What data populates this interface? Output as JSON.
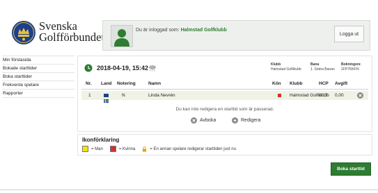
{
  "brand": {
    "line1": "Svenska",
    "line2": "Golfförbundet"
  },
  "login": {
    "text": "Du är inloggad som:",
    "club": "Halmstad Golfklubb",
    "logout_label": "Logga ut"
  },
  "sidebar": {
    "items": [
      {
        "label": "Min förstasida"
      },
      {
        "label": "Bokade starttider"
      },
      {
        "label": "Boka starttider"
      },
      {
        "label": "Frekventa spelare"
      },
      {
        "label": "Rapporter"
      }
    ]
  },
  "booking": {
    "datetime": "2018-04-19, 15:42",
    "info": {
      "club_label": "Klubb",
      "club_value": "Halmstad Golfklubb",
      "course_label": "Bana",
      "course_value": "1. Södra Banan",
      "booking_label": "Bokningsnr.",
      "booking_value": "1FP7RKFN"
    },
    "columns": {
      "nr": "Nr.",
      "land": "Land",
      "notering": "Notering",
      "namn": "Namn",
      "kon": "Kön",
      "klubb": "Klubb",
      "hcp": "HCP",
      "avgift": "Avgift"
    },
    "rows": [
      {
        "nr": "1",
        "notering": "N",
        "namn": "Linda Nevrén",
        "klubb": "Halmstad Golfklubb",
        "hcp": "10,7",
        "avgift": "0,00"
      }
    ],
    "notice": "Du kan inte redigera en starttid som är passerad.",
    "cancel_label": "Avboka",
    "edit_label": "Redigera"
  },
  "legend": {
    "title": "Ikonförklaring",
    "man": "= Man",
    "woman": "= Kvinna",
    "lock": "= En annan spelare redigerar starttiden just nu"
  },
  "book_button": "Boka starttid",
  "colors": {
    "accent_green": "#2e7d32",
    "female": "#d32f2f",
    "male": "#f5e400"
  }
}
